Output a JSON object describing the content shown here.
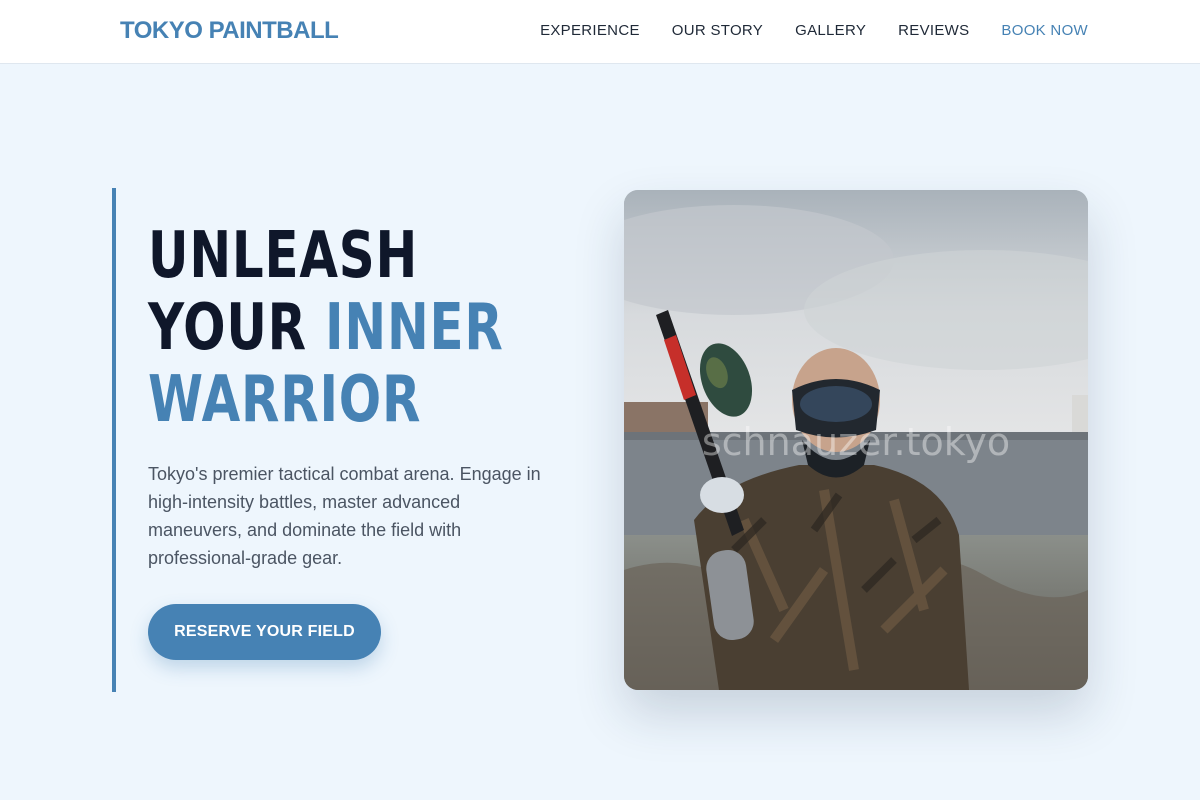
{
  "header": {
    "brand": "TOKYO PAINTBALL",
    "nav": [
      "EXPERIENCE",
      "OUR STORY",
      "GALLERY",
      "REVIEWS",
      "BOOK NOW"
    ]
  },
  "hero": {
    "headline_line1": "UNLEASH",
    "headline_line2a": "YOUR",
    "headline_line2b": "INNER",
    "headline_line3": "WARRIOR",
    "lead": "Tokyo's premier tactical combat arena. Engage in high-intensity battles, master advanced maneuvers, and dominate the field with professional-grade gear.",
    "cta": "RESERVE YOUR FIELD",
    "photo_watermark": "schnauzer.tokyo"
  },
  "colors": {
    "accent": "#4682b4",
    "text": "#0f172a",
    "muted": "#4b5563",
    "background": "#eef6fd"
  }
}
